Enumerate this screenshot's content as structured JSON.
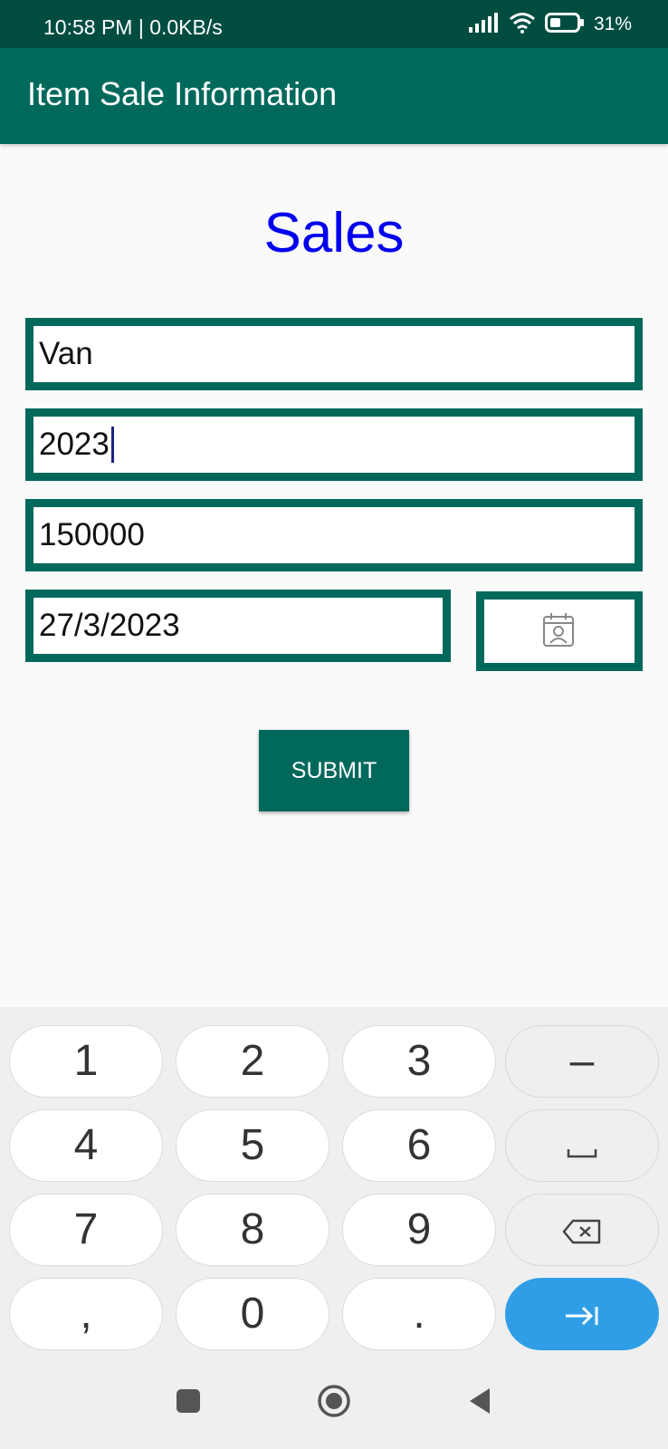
{
  "status_bar": {
    "time": "10:58 PM | 0.0KB/s",
    "battery": "31%",
    "icons": [
      "signal-icon",
      "wifi-icon",
      "battery-icon"
    ]
  },
  "app_bar": {
    "title": "Item Sale Information"
  },
  "form": {
    "heading": "Sales",
    "item_value": "Van",
    "year_value": "2023",
    "amount_value": "150000",
    "date_value": "27/3/2023",
    "submit_label": "SUBMIT"
  },
  "keyboard": {
    "row1": [
      "1",
      "2",
      "3",
      "–"
    ],
    "row2": [
      "4",
      "5",
      "6"
    ],
    "row3": [
      "7",
      "8",
      "9"
    ],
    "row4": [
      ",",
      "0",
      "."
    ]
  },
  "colors": {
    "primary": "#00695c",
    "primary_dark": "#004d40",
    "heading": "#0000ee",
    "enter_key": "#2f9ee6"
  }
}
